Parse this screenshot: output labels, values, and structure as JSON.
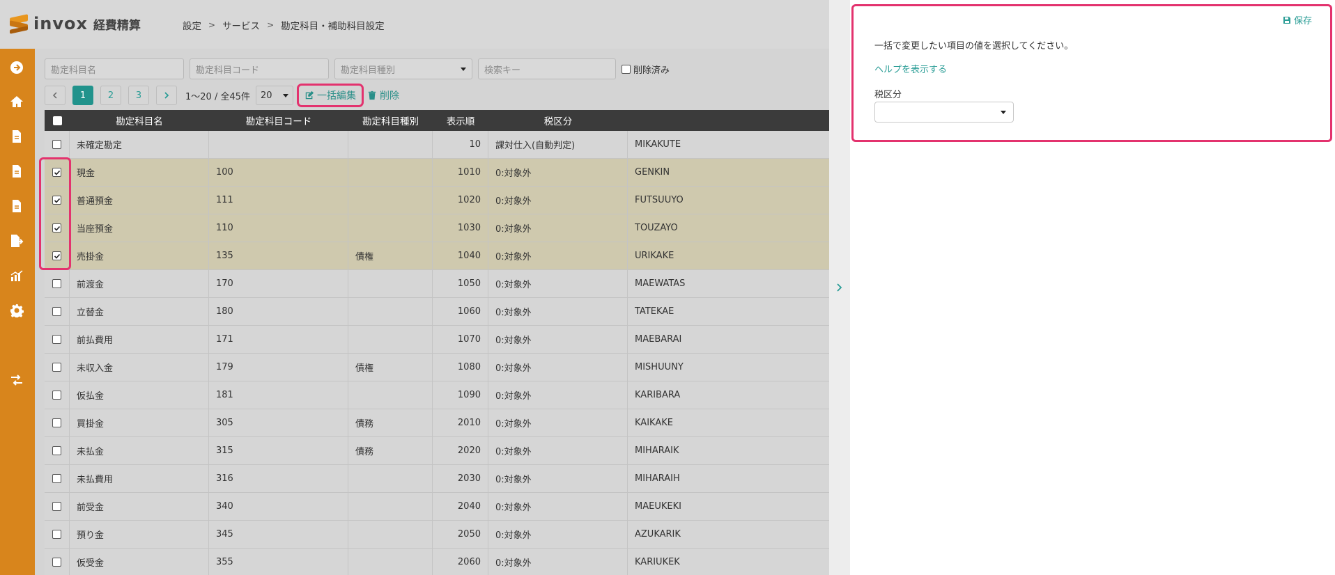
{
  "app": {
    "logo_text": "invox",
    "logo_sub": "経費精算"
  },
  "breadcrumb": [
    "設定",
    "サービス",
    "勘定科目・補助科目設定"
  ],
  "sidebar": {
    "items": [
      "arrow-right-circle-icon",
      "home-icon",
      "document-icon",
      "document-icon",
      "document-icon",
      "document-export-icon",
      "chart-icon",
      "gear-icon",
      "swap-icon"
    ]
  },
  "filters": {
    "name_placeholder": "勘定科目名",
    "code_placeholder": "勘定科目コード",
    "type_placeholder": "勘定科目種別",
    "search_placeholder": "検索キー",
    "deleted_label": "削除済み"
  },
  "toolbar": {
    "pages": [
      "1",
      "2",
      "3"
    ],
    "active_page": "1",
    "count": "1〜20 / 全45件",
    "per_page": "20",
    "bulk_edit_label": "一括編集",
    "delete_label": "削除"
  },
  "table": {
    "headers": [
      "勘定科目名",
      "勘定科目コード",
      "勘定科目種別",
      "表示順",
      "税区分"
    ],
    "rows": [
      {
        "name": "未確定勘定",
        "code": "",
        "type": "",
        "order": "10",
        "tax": "課対仕入(自動判定)",
        "key": "MIKAKUTE",
        "checked": false
      },
      {
        "name": "現金",
        "code": "100",
        "type": "",
        "order": "1010",
        "tax": "0:対象外",
        "key": "GENKIN",
        "checked": true
      },
      {
        "name": "普通預金",
        "code": "111",
        "type": "",
        "order": "1020",
        "tax": "0:対象外",
        "key": "FUTSUUYO",
        "checked": true
      },
      {
        "name": "当座預金",
        "code": "110",
        "type": "",
        "order": "1030",
        "tax": "0:対象外",
        "key": "TOUZAYO",
        "checked": true
      },
      {
        "name": "売掛金",
        "code": "135",
        "type": "債権",
        "order": "1040",
        "tax": "0:対象外",
        "key": "URIKAKE",
        "checked": true
      },
      {
        "name": "前渡金",
        "code": "170",
        "type": "",
        "order": "1050",
        "tax": "0:対象外",
        "key": "MAEWATAS",
        "checked": false
      },
      {
        "name": "立替金",
        "code": "180",
        "type": "",
        "order": "1060",
        "tax": "0:対象外",
        "key": "TATEKAE",
        "checked": false
      },
      {
        "name": "前払費用",
        "code": "171",
        "type": "",
        "order": "1070",
        "tax": "0:対象外",
        "key": "MAEBARAI",
        "checked": false
      },
      {
        "name": "未収入金",
        "code": "179",
        "type": "債権",
        "order": "1080",
        "tax": "0:対象外",
        "key": "MISHUUNY",
        "checked": false
      },
      {
        "name": "仮払金",
        "code": "181",
        "type": "",
        "order": "1090",
        "tax": "0:対象外",
        "key": "KARIBARA",
        "checked": false
      },
      {
        "name": "買掛金",
        "code": "305",
        "type": "債務",
        "order": "2010",
        "tax": "0:対象外",
        "key": "KAIKAKE",
        "checked": false
      },
      {
        "name": "未払金",
        "code": "315",
        "type": "債務",
        "order": "2020",
        "tax": "0:対象外",
        "key": "MIHARAIK",
        "checked": false
      },
      {
        "name": "未払費用",
        "code": "316",
        "type": "",
        "order": "2030",
        "tax": "0:対象外",
        "key": "MIHARAIH",
        "checked": false
      },
      {
        "name": "前受金",
        "code": "340",
        "type": "",
        "order": "2040",
        "tax": "0:対象外",
        "key": "MAEUKEKI",
        "checked": false
      },
      {
        "name": "預り金",
        "code": "345",
        "type": "",
        "order": "2050",
        "tax": "0:対象外",
        "key": "AZUKARIK",
        "checked": false
      },
      {
        "name": "仮受金",
        "code": "355",
        "type": "",
        "order": "2060",
        "tax": "0:対象外",
        "key": "KARIUKEK",
        "checked": false
      }
    ]
  },
  "panel": {
    "save_label": "保存",
    "instruction": "一括で変更したい項目の値を選択してください。",
    "help_link": "ヘルプを表示する",
    "field_label": "税区分",
    "field_value": ""
  },
  "colors": {
    "sidebar": "#d8851c",
    "accent": "#2a9d96",
    "highlight": "#e3326e",
    "selected_row": "#cfc9ae"
  }
}
